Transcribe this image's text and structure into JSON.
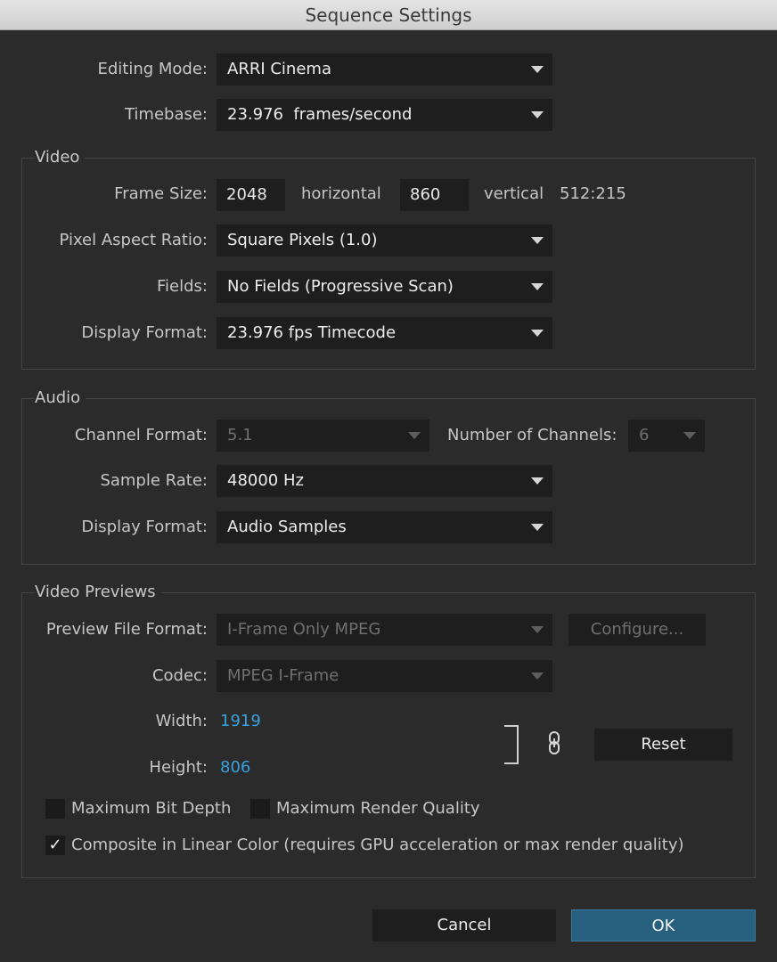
{
  "window": {
    "title": "Sequence Settings"
  },
  "editing_mode": {
    "label": "Editing Mode:",
    "value": "ARRI Cinema"
  },
  "timebase": {
    "label": "Timebase:",
    "value": "23.976  frames/second"
  },
  "video": {
    "section_title": "Video",
    "frame_size": {
      "label": "Frame Size:",
      "horizontal_value": "2048",
      "horizontal_label": "horizontal",
      "vertical_value": "860",
      "vertical_label": "vertical",
      "aspect": "512:215"
    },
    "pixel_aspect": {
      "label": "Pixel Aspect Ratio:",
      "value": "Square Pixels (1.0)"
    },
    "fields": {
      "label": "Fields:",
      "value": "No Fields (Progressive Scan)"
    },
    "display_format": {
      "label": "Display Format:",
      "value": "23.976 fps Timecode"
    }
  },
  "audio": {
    "section_title": "Audio",
    "channel_format": {
      "label": "Channel Format:",
      "value": "5.1"
    },
    "num_channels": {
      "label": "Number of Channels:",
      "value": "6"
    },
    "sample_rate": {
      "label": "Sample Rate:",
      "value": "48000 Hz"
    },
    "display_format": {
      "label": "Display Format:",
      "value": "Audio Samples"
    }
  },
  "previews": {
    "section_title": "Video Previews",
    "file_format": {
      "label": "Preview File Format:",
      "value": "I-Frame Only MPEG"
    },
    "configure_label": "Configure...",
    "codec": {
      "label": "Codec:",
      "value": "MPEG I-Frame"
    },
    "width": {
      "label": "Width:",
      "value": "1919"
    },
    "height": {
      "label": "Height:",
      "value": "806"
    },
    "reset_label": "Reset",
    "max_bit_depth": {
      "label": "Maximum Bit Depth",
      "checked": false
    },
    "max_render_quality": {
      "label": "Maximum Render Quality",
      "checked": false
    },
    "composite_linear": {
      "label": "Composite in Linear Color (requires GPU acceleration or max render quality)",
      "checked": true,
      "check_glyph": "✓"
    }
  },
  "footer": {
    "cancel_label": "Cancel",
    "ok_label": "OK"
  },
  "colors": {
    "accent_blue": "#3aa0dc",
    "ok_button": "#275f7f",
    "background": "#2b2b2b"
  }
}
